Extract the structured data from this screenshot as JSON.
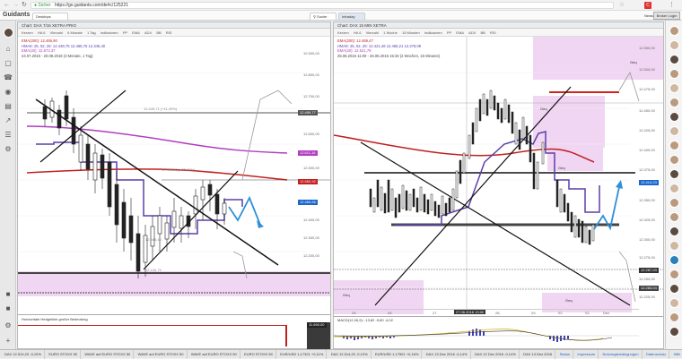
{
  "browser": {
    "secure_label": "Sicher",
    "url": "https://go.guidants.com/de#c/125221",
    "user_badge": "C",
    "login_button": "Broker Login"
  },
  "app": {
    "logo": "Guidants",
    "tabs": [
      "Desktops",
      "Suche",
      "Intraday"
    ],
    "news_button": "News"
  },
  "left_panel": {
    "title": "Chart: DAX 7/16 XETRA PRIO",
    "toolbar": [
      "Kerzen",
      "HA 6",
      "Vierzahl",
      "6 Monate",
      "1 Tag",
      "Indikatoren",
      "PP",
      "EMA",
      "ADX",
      "BB",
      "RSI"
    ],
    "legend_lines": [
      "EMA(200): 12.465,90",
      "HMA8: 25, 52, 26: 12.448,75  12.466,75  12.345,40",
      "EMA(20): 12.673,37",
      "24.07.2016 - 20.08.2016 (3 Monate, 1 Tag)"
    ],
    "price_labels": [
      {
        "text": "12.459,77",
        "color": "#555555"
      },
      {
        "text": "12.611,16",
        "color": "#b23cc1"
      },
      {
        "text": "12.552,92",
        "color": "#c21f1f"
      },
      {
        "text": "12.460,66",
        "color": "#1a66cc"
      }
    ],
    "axis_labels": [
      "12.900,00",
      "12.800,00",
      "12.700,00",
      "12.600,00",
      "12.500,00",
      "12.400,00",
      "12.300,00",
      "12.200,00",
      "12.100,00",
      "12.000,00",
      "11.900,00"
    ],
    "annotations": [
      "12.449,71  (+11,49%)",
      "12.386,80 (+35,00%)",
      "12.348,40",
      "12.100,70"
    ],
    "sub_panel_title": "Horizontale Hedgelinie großer Bedeutung",
    "sub_tag": "11.650,00"
  },
  "right_panel": {
    "title": "Chart: DAX 15 MIN XETRA",
    "toolbar": [
      "Kerzen",
      "HA 6",
      "Vierzahl",
      "1 Woche",
      "15 Minuten",
      "Indikatoren",
      "PP",
      "EMA",
      "ADX",
      "BB",
      "RSI"
    ],
    "legend_lines": [
      "EMA(200): 12.469,47",
      "HMA8: 25, 52, 26: 12.421,46  12.466,21  12.278,09",
      "EMA(20): 12.521,79",
      "25.06.2016 11:00 - 26.06.2016 15:33 (2 Wochen, 15 Minuten)"
    ],
    "price_labels": [
      {
        "text": "12.414,23",
        "color": "#1a66cc"
      },
      {
        "text": "12.287,93",
        "color": "#333333"
      },
      {
        "text": "12.283,04",
        "color": "#444444"
      }
    ],
    "zone_labels": [
      "Geq",
      "Geq",
      "Geq",
      "Geq",
      "Geq"
    ],
    "axis_labels": [
      "12.550,00",
      "12.500,00",
      "12.475,00",
      "12.450,00",
      "12.425,00",
      "12.400,00",
      "12.375,00",
      "12.350,00",
      "12.325,00",
      "12.300,00",
      "12.275,00",
      "12.250,00",
      "12.225,00"
    ],
    "x_labels": [
      "25.",
      "26.",
      "27.",
      "28.",
      "29.",
      "02.",
      "03.",
      "Dez"
    ],
    "cursor_label": "27.06.2016 13:00",
    "macd_legend": "MACD(12,26,9): -13,82   -9,80   -4,02"
  },
  "status_bar": {
    "items": [
      "DAX 12.514,20 -0,10%",
      "EURO STOXX 50",
      "WAVE auf EURO STOXX 50",
      "WAVE auf EURO STOXX 50",
      "WAVE auf EURO STOXX 50",
      "EURO STOXX 50",
      "EUR/USD 1,17321 +0,11%",
      "DAX 12.514,20 -0,10%",
      "EUR/USD 1,17501 +0,16%",
      "DAX 13 Dez 2016 -0,14%",
      "DAX 12 Dez 2016 -0,14%",
      "DAX 13 Dez 2016"
    ],
    "links": [
      "Status",
      "Impressum",
      "Nutzungsbedingungen",
      "Datenschutz",
      "Hilfe"
    ]
  },
  "colors": {
    "accent_blue": "#2f8fd8",
    "ema200_red": "#c21f1f",
    "ema20_magenta": "#b23cc1",
    "trend_purple": "#5b3fa8",
    "zone_pink": "#f0d6f2"
  },
  "icons": [
    "back-arrow-icon",
    "forward-arrow-icon",
    "reload-icon",
    "lock-icon",
    "star-icon",
    "menu-icon",
    "search-icon",
    "gear-icon",
    "home-icon",
    "chart-icon",
    "bell-icon",
    "folder-icon",
    "settings-icon",
    "add-icon"
  ]
}
